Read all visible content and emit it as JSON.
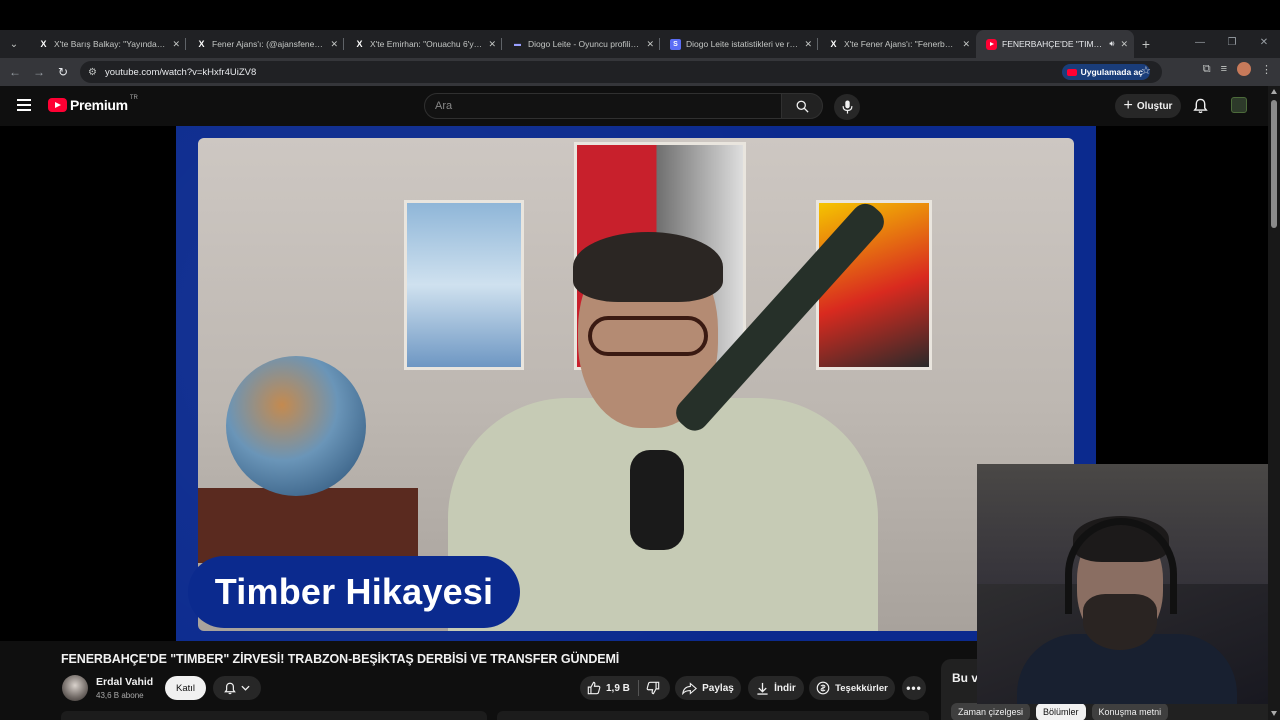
{
  "browser": {
    "tabs": [
      {
        "icon": "x-logo-icon",
        "title": "X'te Barış Balkay: \"Yayındayım. İ",
        "active": false
      },
      {
        "icon": "x-logo-icon",
        "title": "Fener Ajans'ı: (@ajansfenercom)",
        "active": false
      },
      {
        "icon": "x-logo-icon",
        "title": "X'te Emirhan: \"Onuachu 6'ya al",
        "active": false
      },
      {
        "icon": "transfermarkt-icon",
        "title": "Diogo Leite - Oyuncu profili 25",
        "active": false
      },
      {
        "icon": "stats-site-icon",
        "title": "Diogo Leite istatistikleri ve reyti",
        "active": false
      },
      {
        "icon": "x-logo-icon",
        "title": "X'te Fener Ajans'ı: \"Fenerbahç",
        "active": false
      },
      {
        "icon": "youtube-icon",
        "title": "FENERBAHÇE'DE \"TIMBER\"",
        "active": true
      }
    ],
    "url": "youtube.com/watch?v=kHxfr4UiZV8",
    "open_in_app_label": "Uygulamada aç"
  },
  "youtube": {
    "logo_text": "Premium",
    "country_code": "TR",
    "search_placeholder": "Ara",
    "create_label": "Oluştur"
  },
  "video": {
    "overlay_caption": "Timber Hikayesi",
    "title": "FENERBAHÇE'DE \"TIMBER\" ZİRVESİ! TRABZON-BEŞİKTAŞ DERBİSİ VE TRANSFER GÜNDEMİ",
    "channel_name": "Erdal Vahid",
    "subscribers": "43,6 B abone",
    "join_label": "Katıl",
    "like_count": "1,9 B",
    "share_label": "Paylaş",
    "download_label": "İndir",
    "thanks_label": "Teşekkürler"
  },
  "side_panel": {
    "title": "Bu v",
    "chips": [
      {
        "label": "Zaman çizelgesi",
        "active": false
      },
      {
        "label": "Bölümler",
        "active": true
      },
      {
        "label": "Konuşma metni",
        "active": false
      }
    ]
  },
  "colors": {
    "youtube_red": "#ff0033",
    "frame_blue": "#0b2a8e",
    "app_button_blue": "#1a3d7a"
  }
}
